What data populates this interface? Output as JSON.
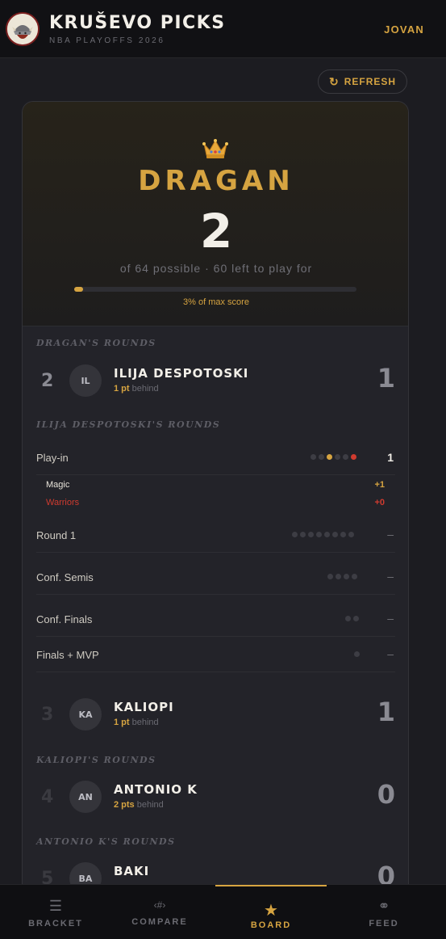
{
  "header": {
    "title": "KRUŠEVO PICKS",
    "subtitle": "NBA PLAYOFFS 2026",
    "user": "JOVAN",
    "logo_icon": "viking-helmet-logo"
  },
  "refresh_label": "REFRESH",
  "leader": {
    "name": "DRAGAN",
    "score": "2",
    "possible_text": "of 64 possible · 60 left to play for",
    "progress_fraction": 0.03,
    "progress_label": "3% of max score"
  },
  "sections": {
    "dragan_rounds": "DRAGAN'S ROUNDS",
    "ilija_rounds": "ILIJA DESPOTOSKI'S ROUNDS",
    "kaliopi_rounds": "KALIOPI'S ROUNDS",
    "antonio_rounds": "ANTONIO K'S ROUNDS"
  },
  "players": [
    {
      "rank": "2",
      "initials": "IL",
      "name": "ILIJA DESPOTOSKI",
      "behind_pts": "1 pt",
      "behind_word": "behind",
      "score": "1"
    },
    {
      "rank": "3",
      "initials": "KA",
      "name": "KALIOPI",
      "behind_pts": "1 pt",
      "behind_word": "behind",
      "score": "1"
    },
    {
      "rank": "4",
      "initials": "AN",
      "name": "ANTONIO K",
      "behind_pts": "2 pts",
      "behind_word": "behind",
      "score": "0"
    },
    {
      "rank": "5",
      "initials": "BA",
      "name": "BAKI",
      "behind_pts": "",
      "behind_word": "",
      "score": "0"
    }
  ],
  "rounds": [
    {
      "name": "Play-in",
      "dots": [
        "empty",
        "empty",
        "hit",
        "empty",
        "empty",
        "miss"
      ],
      "score": "1"
    },
    {
      "name": "Round 1",
      "dots": [
        "empty",
        "empty",
        "empty",
        "empty",
        "empty",
        "empty",
        "empty",
        "empty"
      ],
      "score": "–"
    },
    {
      "name": "Conf. Semis",
      "dots": [
        "empty",
        "empty",
        "empty",
        "empty"
      ],
      "score": "–"
    },
    {
      "name": "Conf. Finals",
      "dots": [
        "empty",
        "empty"
      ],
      "score": "–"
    },
    {
      "name": "Finals + MVP",
      "dots": [
        "empty"
      ],
      "score": "–"
    }
  ],
  "picks": [
    {
      "team": "Magic",
      "pts": "+1",
      "color": "#cfcbc2",
      "pts_color": "#d6a441"
    },
    {
      "team": "Warriors",
      "pts": "+0",
      "color": "#d03b2f",
      "pts_color": "#d03b2f"
    }
  ],
  "nav": [
    {
      "label": "BRACKET",
      "icon": "☰",
      "icon_name": "menu-icon"
    },
    {
      "label": "COMPARE",
      "icon": "‹#›",
      "icon_name": "compare-icon"
    },
    {
      "label": "BOARD",
      "icon": "★",
      "icon_name": "star-icon"
    },
    {
      "label": "FEED",
      "icon": "⚭",
      "icon_name": "feed-icon"
    }
  ],
  "colors": {
    "accent": "#d6a441",
    "miss": "#d03b2f",
    "background": "#1c1c21"
  }
}
